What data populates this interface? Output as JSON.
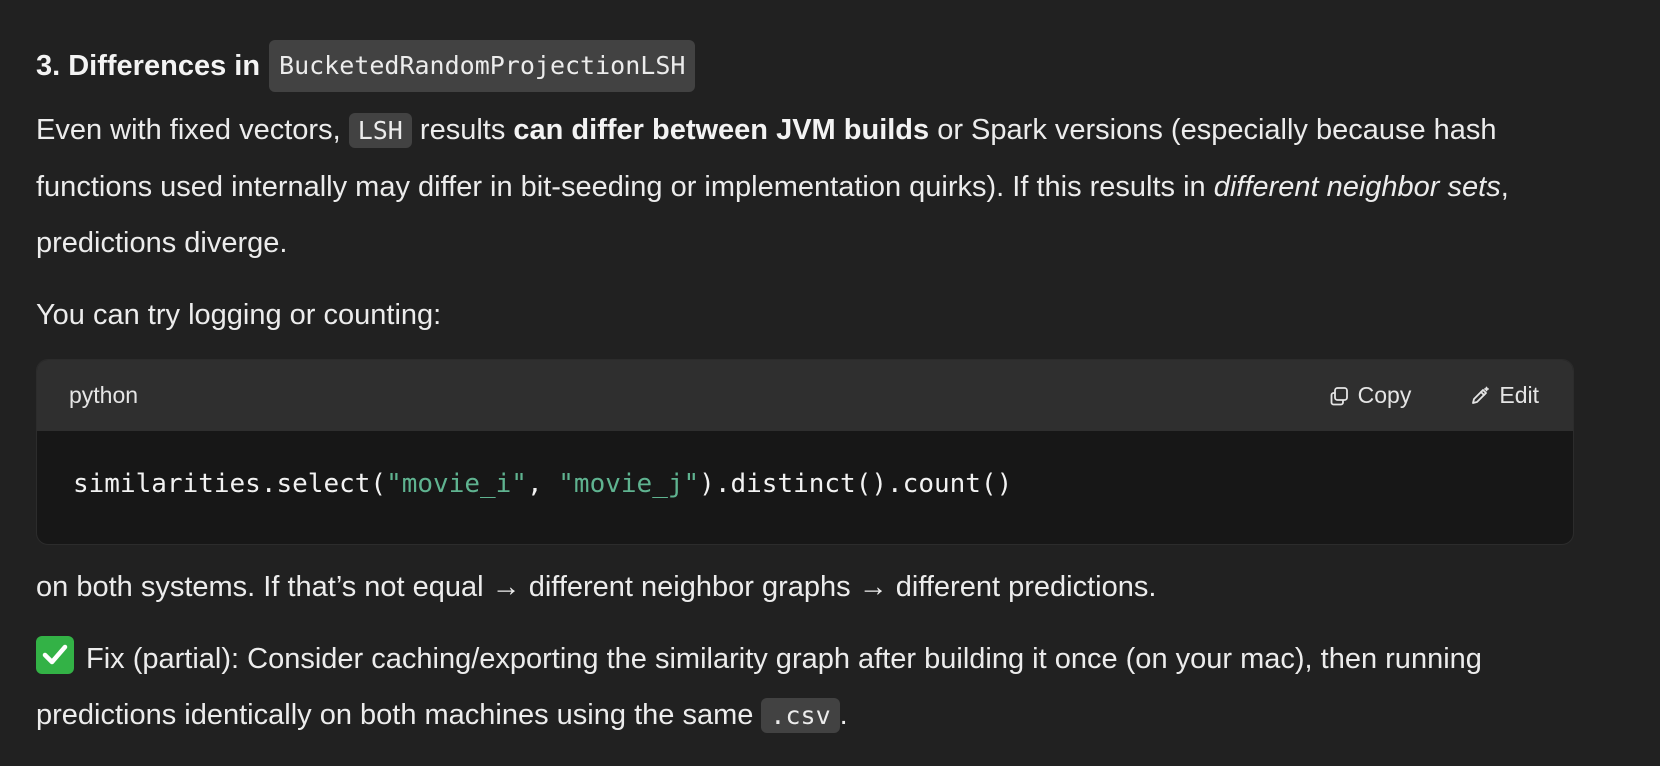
{
  "section": {
    "heading_prefix": "3. Differences in",
    "heading_code": "BucketedRandomProjectionLSH"
  },
  "para1": {
    "t1": "Even with fixed vectors,",
    "code": "LSH",
    "t2": "results",
    "bold": "can differ between JVM builds",
    "t3": "or Spark versions (especially because hash functions used internally may differ in bit-seeding or implementation quirks). If this results in",
    "italic": "different neighbor sets",
    "t4": ", predictions diverge."
  },
  "para2": {
    "text": "You can try logging or counting:"
  },
  "codeblock": {
    "language": "python",
    "copy_label": "Copy",
    "edit_label": "Edit",
    "code_pre": "similarities.select(",
    "str1": "\"movie_i\"",
    "code_mid": ", ",
    "str2": "\"movie_j\"",
    "code_post": ").distinct().count()",
    "string_color": "#5fb390"
  },
  "para3": {
    "text": "on both systems. If that’s not equal → different neighbor graphs → different predictions."
  },
  "para4": {
    "icon": "check-mark-button-icon",
    "t1": "Fix (partial): Consider caching/exporting the similarity graph after building it once (on your mac), then running predictions identically on both machines using the same",
    "code": ".csv",
    "t2": "."
  },
  "colors": {
    "background": "#212121",
    "code_header": "#2f2f2f",
    "code_body": "#171717",
    "checkbox_green": "#33b246"
  }
}
